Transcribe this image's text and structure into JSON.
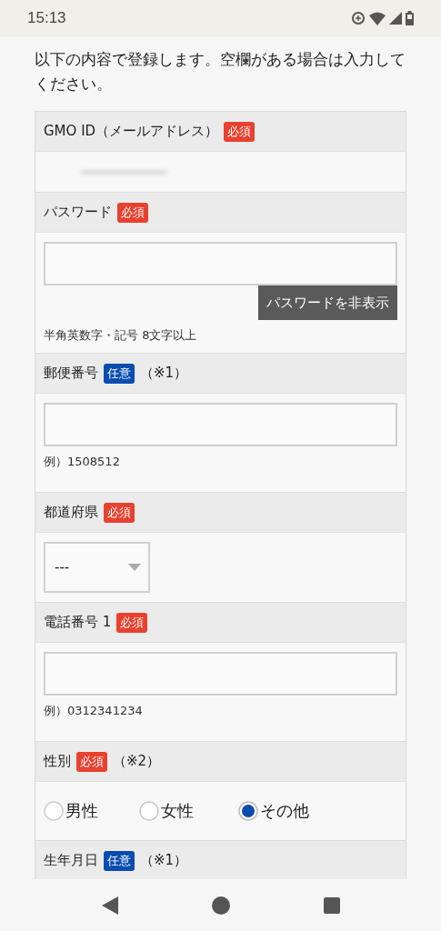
{
  "status_bar": {
    "time": "15:13"
  },
  "intro": "以下の内容で登録します。空欄がある場合は入力してください。",
  "sections": [
    {
      "kind": "email",
      "label": "GMO ID（メールアドレス）",
      "badge": {
        "text": "必須",
        "kind": "required"
      }
    },
    {
      "kind": "password",
      "label": "パスワード",
      "badge": {
        "text": "必須",
        "kind": "required"
      },
      "toggle": "パスワードを非表示",
      "hint": "半角英数字・記号 8文字以上"
    },
    {
      "kind": "text",
      "label": "郵便番号",
      "badge": {
        "text": "任意",
        "kind": "optional"
      },
      "note": "（※1）",
      "hint": "例）1508512"
    },
    {
      "kind": "select",
      "label": "都道府県",
      "badge": {
        "text": "必須",
        "kind": "required"
      },
      "value": "---"
    },
    {
      "kind": "text",
      "label": "電話番号 1",
      "badge": {
        "text": "必須",
        "kind": "required"
      },
      "hint": "例）0312341234"
    },
    {
      "kind": "radio",
      "label": "性別",
      "badge": {
        "text": "必須",
        "kind": "required"
      },
      "note": "（※2）",
      "options": [
        {
          "label": "男性",
          "selected": false
        },
        {
          "label": "女性",
          "selected": false
        },
        {
          "label": "その他",
          "selected": true
        }
      ]
    },
    {
      "kind": "header",
      "label": "生年月日",
      "badge": {
        "text": "任意",
        "kind": "optional"
      },
      "note": "（※1）"
    }
  ]
}
